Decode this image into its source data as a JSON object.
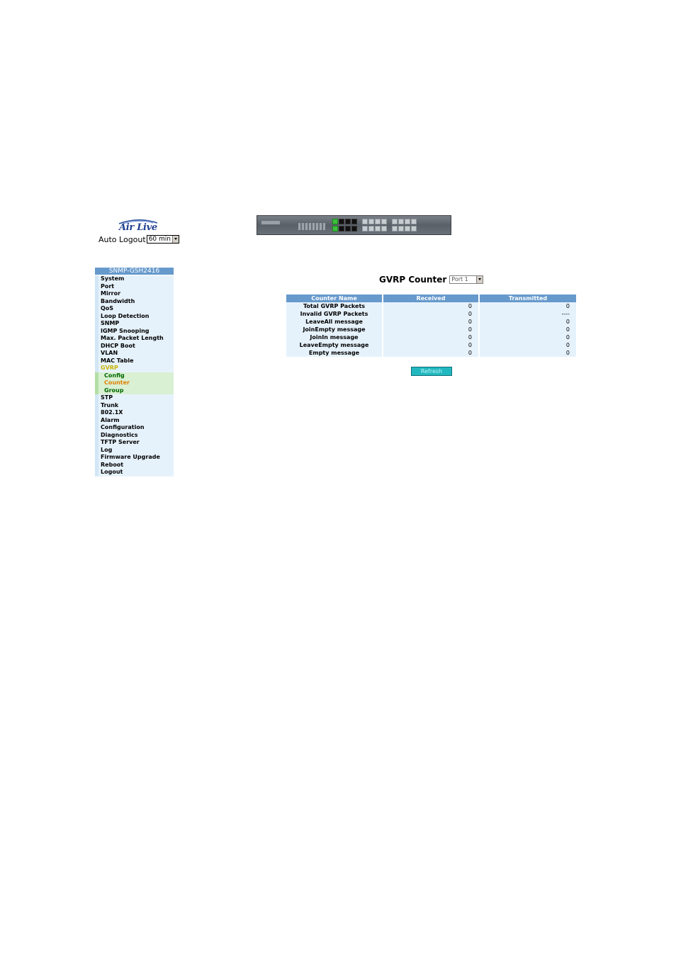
{
  "header": {
    "logo_text": "Air Live",
    "auto_logout_label": "Auto Logout",
    "auto_logout_value": "60 min"
  },
  "sidebar": {
    "title": "SNMP-GSH2416",
    "items": [
      {
        "label": "System"
      },
      {
        "label": "Port"
      },
      {
        "label": "Mirror"
      },
      {
        "label": "Bandwidth"
      },
      {
        "label": "QoS"
      },
      {
        "label": "Loop Detection"
      },
      {
        "label": "SNMP"
      },
      {
        "label": "IGMP Snooping"
      },
      {
        "label": "Max. Packet Length"
      },
      {
        "label": "DHCP Boot"
      },
      {
        "label": "VLAN"
      },
      {
        "label": "MAC Table"
      },
      {
        "label": "GVRP",
        "active": true
      },
      {
        "label": "Config",
        "sub": true
      },
      {
        "label": "Counter",
        "sub": true,
        "active": true
      },
      {
        "label": "Group",
        "sub": true
      },
      {
        "label": "STP"
      },
      {
        "label": "Trunk"
      },
      {
        "label": "802.1X"
      },
      {
        "label": "Alarm"
      },
      {
        "label": "Configuration"
      },
      {
        "label": "Diagnostics"
      },
      {
        "label": "TFTP Server"
      },
      {
        "label": "Log"
      },
      {
        "label": "Firmware Upgrade"
      },
      {
        "label": "Reboot"
      },
      {
        "label": "Logout"
      }
    ]
  },
  "main": {
    "title": "GVRP Counter",
    "port_select_value": "Port 1",
    "table": {
      "columns": [
        "Counter Name",
        "Received",
        "Transmitted"
      ],
      "rows": [
        [
          "Total GVRP Packets",
          "0",
          "0"
        ],
        [
          "Invalid GVRP Packets",
          "0",
          "----"
        ],
        [
          "LeaveAll message",
          "0",
          "0"
        ],
        [
          "JoinEmpty message",
          "0",
          "0"
        ],
        [
          "JoinIn message",
          "0",
          "0"
        ],
        [
          "LeaveEmpty message",
          "0",
          "0"
        ],
        [
          "Empty message",
          "0",
          "0"
        ]
      ]
    },
    "refresh_label": "Refresh"
  },
  "colors": {
    "header_blue": "#6699cc",
    "row_light": "#e6f2fb",
    "submenu_green": "#d9f0d3",
    "refresh_teal": "#22b8c0"
  }
}
